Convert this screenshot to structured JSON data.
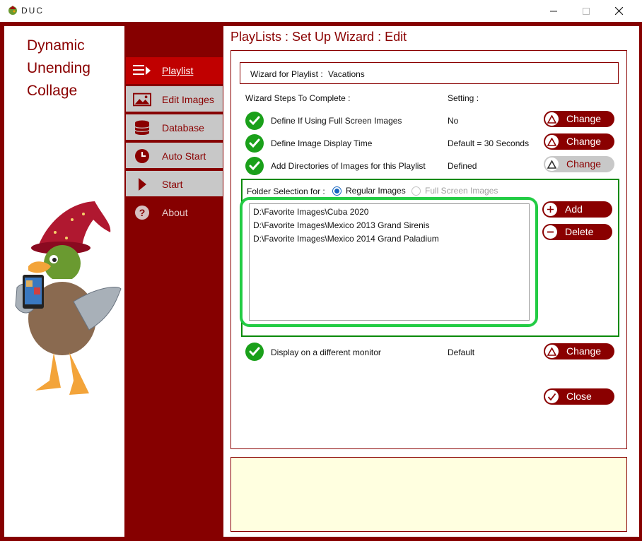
{
  "window": {
    "title": "DUC"
  },
  "logo": {
    "line1": "Dynamic",
    "line2": "Unending",
    "line3": "Collage"
  },
  "nav": {
    "items": [
      {
        "label": "Playlist",
        "icon": "playlist-icon"
      },
      {
        "label": "Edit Images",
        "icon": "image-icon"
      },
      {
        "label": "Database",
        "icon": "database-icon"
      },
      {
        "label": "Auto Start",
        "icon": "clock-icon"
      },
      {
        "label": "Start",
        "icon": "play-icon"
      },
      {
        "label": "About",
        "icon": "help-icon"
      }
    ]
  },
  "page": {
    "title": "PlayLists : Set Up Wizard : Edit"
  },
  "wizard": {
    "name_label": "Wizard for Playlist :",
    "name_value": "Vacations",
    "steps_header": "Wizard Steps To Complete :",
    "setting_header": "Setting :",
    "steps": [
      {
        "label": "Define If Using Full Screen Images",
        "setting": "No",
        "button": "Change"
      },
      {
        "label": "Define Image Display Time",
        "setting": "Default = 30 Seconds",
        "button": "Change"
      },
      {
        "label": "Add Directories of Images for this Playlist",
        "setting": "Defined",
        "button": "Change"
      },
      {
        "label": "Display on a different monitor",
        "setting": "Default",
        "button": "Change"
      }
    ]
  },
  "folder_selection": {
    "label": "Folder Selection for :",
    "option_regular": "Regular Images",
    "option_full": "Full Screen Images",
    "directories": [
      "D:\\Favorite Images\\Cuba 2020",
      "D:\\Favorite Images\\Mexico 2013 Grand Sirenis",
      "D:\\Favorite Images\\Mexico 2014 Grand Paladium"
    ],
    "add_label": "Add",
    "delete_label": "Delete"
  },
  "close_label": "Close",
  "colors": {
    "brand": "#860000",
    "accent_red": "#c00000",
    "success": "#1aa01a",
    "highlight": "#22cc44",
    "status_bg": "#ffffe0"
  }
}
